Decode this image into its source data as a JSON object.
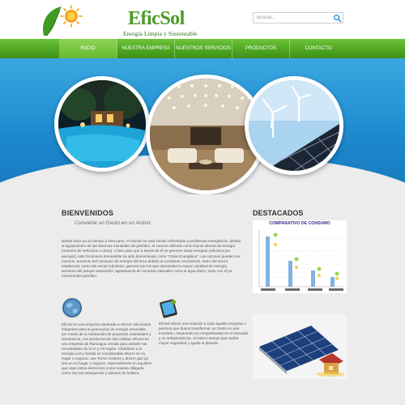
{
  "header": {
    "logo_title": "EficSol",
    "logo_subtitle": "Energía Limpia y Sustentable",
    "search_placeholder": "Buscar..."
  },
  "nav": {
    "items": [
      {
        "label": "INICIO",
        "active": true
      },
      {
        "label": "NUESTRA EMPRESA",
        "active": false
      },
      {
        "label": "NUESTROS SERVICIOS",
        "active": false
      },
      {
        "label": "PRODUCTOS",
        "active": false
      },
      {
        "label": "CONTACTO",
        "active": false
      }
    ]
  },
  "welcome": {
    "title": "BIENVENIDOS",
    "subtitle": "Convierte un Gasto en un Activo.",
    "text": "Desde hace ya un tiempo a ésta parte, el mundo se está viendo enfrentado a problemas energéticos, debido al agotamiento de las reservas mundiales de petróleo, el cual es utilizado como fuente directa de energía (motores de vehículos u otros), o bien para que a través de él se generen otras energías (eléctrica por ejemplo); este fenómeno irreversible ha sido denominado como \"Crisis Energética\". Las razones pueden ser muchas: aumento del consumo de energía eléctrica debido al constante crecimiento, tanto del sector residencial, como del sector industrial, quienes son los que demandan la mayor cantidad de energía, aumento del parque automotriz, agotamiento de recursos naturales como el agua dulce, junto con el ya mencionado petróleo."
  },
  "featured": {
    "title": "DESTACADOS",
    "chart_title": "COMPARATIVO DE CONSUMO"
  },
  "column1": {
    "text": "Eficsol es una empresa dedicada a ofrecer soluciones integrales para la generación de energía renovable, por medio de la realización de proyectos industriales y domésticos, con productos de alta calidad. Eficsol es una empresa de Rancagua creada para atender las necesidades de la VI y VII región. Cámbiese a la energía Led y fuérda un considerable ahorro en su hogar o negocio, use Termo Solares y ahorre gas ya sea en su hogar o negocio, especialmente en aquellos que usan éstos elementos como materia obligada como son las peluquerías y salones de belleza."
  },
  "column2": {
    "text": "Eficsol ofrece una solución a toda aquella empresa o persona que busca transformar un Gasto en una Inversión, mejorando su competitividad en el mercado y su independencia, al mismo tiempo que recibe mayor seguridad y ayuda al planeta."
  },
  "colors": {
    "brand_green": "#4ea722",
    "banner_blue": "#1e8bcf",
    "content_bg": "#ececec"
  },
  "icons": [
    "search-icon",
    "globe-icon",
    "tablet-icon",
    "logo-sun-icon"
  ]
}
